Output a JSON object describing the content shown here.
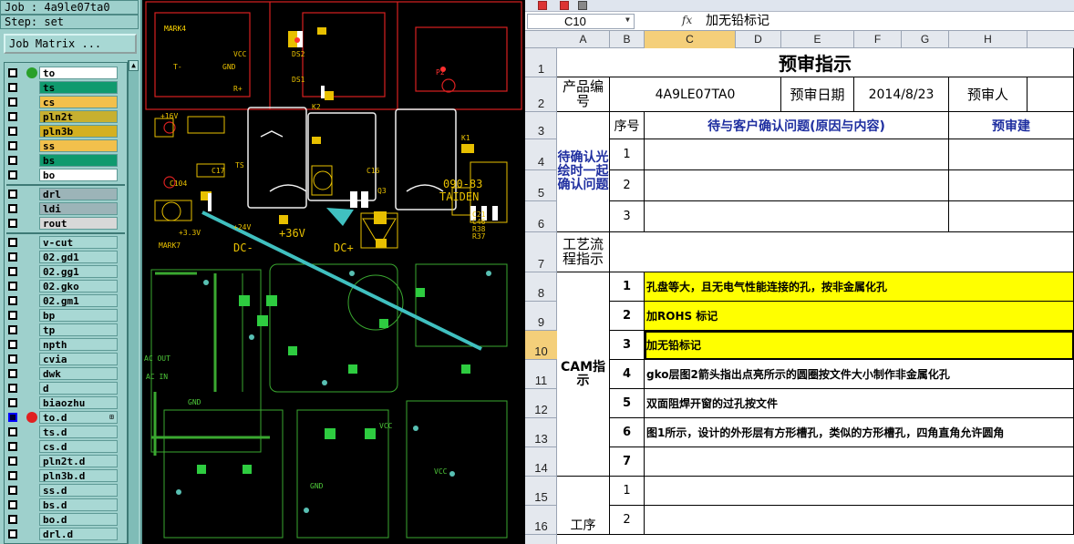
{
  "cam": {
    "job_line": "Job : 4a9le07ta0",
    "step_line": "Step: set",
    "job_matrix_label": "Job Matrix ...",
    "scroll_up": "▲",
    "layers": [
      {
        "name": "to",
        "color": "#ffffff",
        "dot": "#2aa02a"
      },
      {
        "name": "ts",
        "color": "#0f9a6e"
      },
      {
        "name": "cs",
        "color": "#f2c04c"
      },
      {
        "name": "pln2t",
        "color": "#c7b030"
      },
      {
        "name": "pln3b",
        "color": "#d4b020"
      },
      {
        "name": "ss",
        "color": "#f2c04c"
      },
      {
        "name": "bs",
        "color": "#0f9a6e"
      },
      {
        "name": "bo",
        "color": "#ffffff"
      },
      {
        "name": "drl",
        "color": "#9cb4b8"
      },
      {
        "name": "ldi",
        "color": "#9cb4b8"
      },
      {
        "name": "rout",
        "color": "#d8d8d8"
      },
      {
        "name": "v-cut",
        "color": "#a8d8d4"
      },
      {
        "name": "02.gd1",
        "color": "#a8d8d4"
      },
      {
        "name": "02.gg1",
        "color": "#a8d8d4"
      },
      {
        "name": "02.gko",
        "color": "#a8d8d4"
      },
      {
        "name": "02.gm1",
        "color": "#a8d8d4"
      },
      {
        "name": "bp",
        "color": "#a8d8d4"
      },
      {
        "name": "tp",
        "color": "#a8d8d4"
      },
      {
        "name": "npth",
        "color": "#a8d8d4"
      },
      {
        "name": "cvia",
        "color": "#a8d8d4"
      },
      {
        "name": "dwk",
        "color": "#a8d8d4"
      },
      {
        "name": "d",
        "color": "#a8d8d4"
      },
      {
        "name": "biaozhu",
        "color": "#a8d8d4"
      },
      {
        "name": "to.d",
        "color": "#a8d8d4",
        "dot": "#e02020",
        "active": true,
        "mark": "⊞"
      },
      {
        "name": "ts.d",
        "color": "#a8d8d4"
      },
      {
        "name": "cs.d",
        "color": "#a8d8d4"
      },
      {
        "name": "pln2t.d",
        "color": "#a8d8d4"
      },
      {
        "name": "pln3b.d",
        "color": "#a8d8d4"
      },
      {
        "name": "ss.d",
        "color": "#a8d8d4"
      },
      {
        "name": "bs.d",
        "color": "#a8d8d4"
      },
      {
        "name": "bo.d",
        "color": "#a8d8d4"
      },
      {
        "name": "drl.d",
        "color": "#a8d8d4"
      }
    ]
  },
  "pcb": {
    "labels": [
      {
        "text": "MARK4",
        "color": "#ffd700"
      },
      {
        "text": "VCC",
        "color": "#e8c000"
      },
      {
        "text": "GND",
        "color": "#e8c000"
      },
      {
        "text": "DS2",
        "color": "#e8c000"
      },
      {
        "text": "DS1",
        "color": "#e8c000"
      },
      {
        "text": "P2",
        "color": "#ff3030"
      },
      {
        "text": "T-",
        "color": "#e8c000"
      },
      {
        "text": "R+",
        "color": "#e8c000"
      },
      {
        "text": "+36V",
        "color": "#e8c000"
      },
      {
        "text": "K2",
        "color": "#e8c000"
      },
      {
        "text": "K1",
        "color": "#e8c000"
      },
      {
        "text": "TS",
        "color": "#e8c000"
      },
      {
        "text": "C16",
        "color": "#e8c000"
      },
      {
        "text": "Q3",
        "color": "#e8c000"
      },
      {
        "text": "C104",
        "color": "#e8c000"
      },
      {
        "text": "MARK7",
        "color": "#e8c000"
      },
      {
        "text": "+3.3V",
        "color": "#e8c000"
      },
      {
        "text": "DC-",
        "color": "#e8c000"
      },
      {
        "text": "DC+",
        "color": "#e8c000"
      },
      {
        "text": "090-83",
        "color": "#e8c000"
      },
      {
        "text": "TAIDEN",
        "color": "#e8c000"
      },
      {
        "text": "C46",
        "color": "#e8c000"
      },
      {
        "text": "R38",
        "color": "#e8c000"
      },
      {
        "text": "R37",
        "color": "#e8c000"
      },
      {
        "text": "C21",
        "color": "#e8c000"
      },
      {
        "text": "+16V",
        "color": "#e8c000"
      },
      {
        "text": "C17",
        "color": "#e8c000"
      },
      {
        "text": "+24V",
        "color": "#e8c000"
      },
      {
        "text": "VCC",
        "color": "#4ec83a"
      },
      {
        "text": "GND",
        "color": "#4ec83a"
      },
      {
        "text": "AC OUT",
        "color": "#4ec83a"
      },
      {
        "text": "AC IN",
        "color": "#4ec83a"
      },
      {
        "text": "GND",
        "color": "#4ec83a"
      },
      {
        "text": "VCC",
        "color": "#4ec83a"
      }
    ]
  },
  "excel": {
    "name_box": "C10",
    "fx": "fx",
    "formula": "加无铅标记",
    "columns": [
      "A",
      "B",
      "C",
      "D",
      "E",
      "F",
      "G",
      "H"
    ],
    "rows": [
      "1",
      "2",
      "3",
      "4",
      "5",
      "6",
      "7",
      "8",
      "9",
      "10",
      "11",
      "12",
      "13",
      "14",
      "15",
      "16"
    ],
    "title": "预审指示",
    "product_no_label": "产品编号",
    "product_no_value": "4A9LE07TA0",
    "review_date_label": "预审日期",
    "review_date_value": "2014/8/23",
    "reviewer_label": "预审人",
    "seq_label": "序号",
    "pending_header": "待与客户确认问题(原因与内容)",
    "review_col_header": "预审建",
    "pending_group_label": "待确认光绘时一起确认问题",
    "pending_seq": [
      "1",
      "2",
      "3"
    ],
    "process_label": "工艺流程指示",
    "cam_label": "CAM指示",
    "cam_items": [
      {
        "seq": "1",
        "text": "孔盘等大，且无电气性能连接的孔，按非金属化孔",
        "highlight": true
      },
      {
        "seq": "2",
        "text": "加ROHS 标记",
        "highlight": true
      },
      {
        "seq": "3",
        "text": "加无铅标记",
        "highlight": true
      },
      {
        "seq": "4",
        "text": "gko层图2箭头指出点亮所示的圆圈按文件大小制作非金属化孔",
        "highlight": false
      },
      {
        "seq": "5",
        "text": "双面阻焊开窗的过孔按文件",
        "highlight": false
      },
      {
        "seq": "6",
        "text": "图1所示，设计的外形层有方形槽孔，类似的方形槽孔，四角直角允许圆角",
        "highlight": false
      },
      {
        "seq": "7",
        "text": "",
        "highlight": false
      }
    ],
    "process2_seq": [
      "1",
      "2"
    ],
    "process2_label": "工序"
  }
}
